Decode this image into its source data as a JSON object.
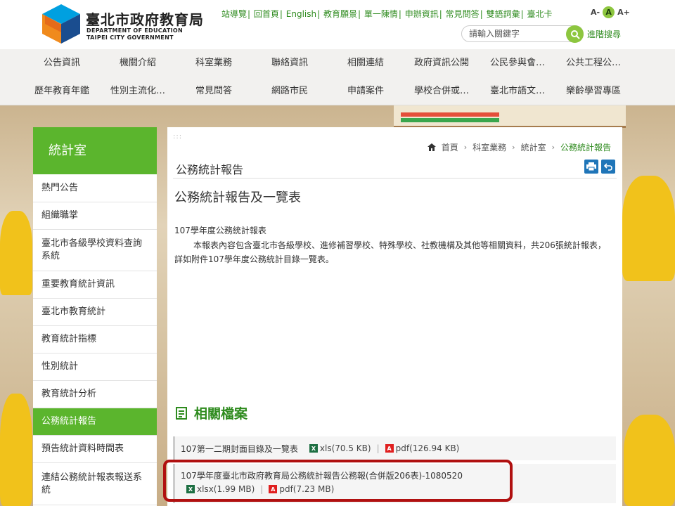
{
  "header": {
    "site_title": "臺北市政府教育局",
    "site_title_en1": "DEPARTMENT OF EDUCATION",
    "site_title_en2": "TAIPEI CITY GOVERNMENT",
    "top_links": [
      "站導覽",
      "回首頁",
      "English",
      "教育願景",
      "單一陳情",
      "申辦資訊",
      "常見問答",
      "雙語詞彙",
      "臺北卡"
    ],
    "font_small": "A-",
    "font_medium": "A",
    "font_large": "A+",
    "search_placeholder": "請輸入關鍵字",
    "advanced_search": "進階搜尋"
  },
  "nav": {
    "row1": [
      "公告資訊",
      "機關介紹",
      "科室業務",
      "聯絡資訊",
      "相關連結",
      "政府資訊公開",
      "公民參與會…",
      "公共工程公…"
    ],
    "row2": [
      "歷年教育年鑑",
      "性別主流化…",
      "常見問答",
      "網路市民",
      "申請案件",
      "學校合併或…",
      "臺北市語文…",
      "樂齡學習專區"
    ]
  },
  "sidebar": {
    "title": "統計室",
    "items": [
      {
        "label": "熱門公告"
      },
      {
        "label": "組織職掌"
      },
      {
        "label": "臺北市各級學校資料查詢系統"
      },
      {
        "label": "重要教育統計資訊"
      },
      {
        "label": "臺北市教育統計"
      },
      {
        "label": "教育統計指標"
      },
      {
        "label": "性別統計"
      },
      {
        "label": "教育統計分析"
      },
      {
        "label": "公務統計報告"
      },
      {
        "label": "預告統計資料時間表"
      },
      {
        "label": "連結公務統計報表報送系統"
      }
    ]
  },
  "main": {
    "dots": ":::",
    "breadcrumb": {
      "home": "首頁",
      "level1": "科室業務",
      "level2": "統計室",
      "current": "公務統計報告"
    },
    "page_title": "公務統計報告",
    "content_title": "公務統計報告及一覽表",
    "content_sub": "107學年度公務統計報表",
    "content_body": "本報表內容包含臺北市各級學校、進修補習學校、特殊學校、社教機構及其他等相關資料，共206張統計報表，詳如附件107學年度公務統計目錄一覽表。",
    "files_heading": "相關檔案",
    "files": [
      {
        "name": "107第一二期封面目錄及一覽表",
        "a1": "xls(70.5 KB)",
        "a2": "pdf(126.94 KB)"
      },
      {
        "name": "107學年度臺北市政府教育局公務統計報告公務報(合併版206表)-1080520",
        "a1": "xlsx(1.99 MB)",
        "a2": "pdf(7.23 MB)"
      }
    ]
  },
  "colors": {
    "accent": "#5bb52d",
    "link": "#2e8b1e",
    "highlight": "#b01010"
  }
}
